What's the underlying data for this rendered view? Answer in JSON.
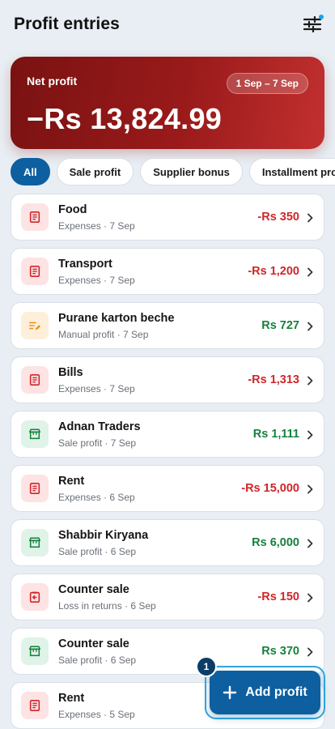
{
  "header": {
    "title": "Profit entries",
    "filter_icon": "sliders-icon"
  },
  "summary": {
    "label": "Net profit",
    "range": "1 Sep – 7 Sep",
    "amount": "−Rs 13,824.99"
  },
  "filters": [
    {
      "label": "All",
      "active": true
    },
    {
      "label": "Sale profit",
      "active": false
    },
    {
      "label": "Supplier bonus",
      "active": false
    },
    {
      "label": "Installment profit",
      "active": false
    }
  ],
  "entries": [
    {
      "title": "Food",
      "subtitle": "Expenses · 7 Sep",
      "amount": "-Rs 350",
      "sign": "neg",
      "kind": "expense",
      "icon": "receipt-icon"
    },
    {
      "title": "Transport",
      "subtitle": "Expenses · 7 Sep",
      "amount": "-Rs 1,200",
      "sign": "neg",
      "kind": "expense",
      "icon": "receipt-icon"
    },
    {
      "title": "Purane karton beche",
      "subtitle": "Manual profit · 7 Sep",
      "amount": "Rs 727",
      "sign": "pos",
      "kind": "manual",
      "icon": "edit-note-icon"
    },
    {
      "title": "Bills",
      "subtitle": "Expenses · 7 Sep",
      "amount": "-Rs 1,313",
      "sign": "neg",
      "kind": "expense",
      "icon": "receipt-icon"
    },
    {
      "title": "Adnan Traders",
      "subtitle": "Sale profit · 7 Sep",
      "amount": "Rs 1,111",
      "sign": "pos",
      "kind": "sale",
      "icon": "store-icon"
    },
    {
      "title": "Rent",
      "subtitle": "Expenses · 6 Sep",
      "amount": "-Rs 15,000",
      "sign": "neg",
      "kind": "expense",
      "icon": "receipt-icon"
    },
    {
      "title": "Shabbir Kiryana",
      "subtitle": "Sale profit · 6 Sep",
      "amount": "Rs 6,000",
      "sign": "pos",
      "kind": "sale",
      "icon": "store-icon"
    },
    {
      "title": "Counter sale",
      "subtitle": "Loss in returns · 6 Sep",
      "amount": "-Rs 150",
      "sign": "neg",
      "kind": "loss",
      "icon": "return-icon"
    },
    {
      "title": "Counter sale",
      "subtitle": "Sale profit · 6 Sep",
      "amount": "Rs 370",
      "sign": "pos",
      "kind": "sale",
      "icon": "store-icon"
    },
    {
      "title": "Rent",
      "subtitle": "Expenses · 5 Sep",
      "amount": "",
      "sign": "neg",
      "kind": "expense",
      "icon": "receipt-icon"
    }
  ],
  "fab": {
    "label": "Add profit",
    "badge": "1",
    "icon": "plus-icon"
  },
  "colors": {
    "primary": "#0d5fa0",
    "negative": "#d0262b",
    "positive": "#17803d",
    "hero": "#8b1515"
  }
}
